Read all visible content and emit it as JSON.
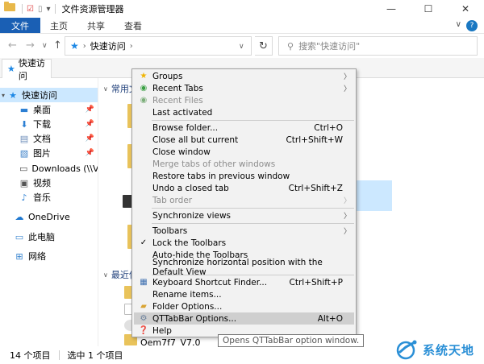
{
  "window": {
    "title": "文件资源管理器",
    "controls": {
      "minimize": "—",
      "maximize": "☐",
      "close": "✕"
    }
  },
  "ribbon": {
    "tabs": [
      "文件",
      "主页",
      "共享",
      "查看"
    ],
    "collapse": "∨",
    "help": "?"
  },
  "address": {
    "back": "←",
    "forward": "→",
    "recent": "∨",
    "up": "↑",
    "path": "快速访问",
    "chevron": "›",
    "dropdown": "∨",
    "refresh": "↻",
    "search_placeholder": "搜索\"快速访问\""
  },
  "qttab": {
    "tab_label": "快速访问"
  },
  "sidebar": {
    "items": [
      {
        "label": "快速访问",
        "icon": "star-icon",
        "pinned": false
      },
      {
        "label": "桌面",
        "icon": "desktop-icon",
        "pinned": true
      },
      {
        "label": "下载",
        "icon": "download-icon",
        "pinned": true
      },
      {
        "label": "文档",
        "icon": "document-icon",
        "pinned": true
      },
      {
        "label": "图片",
        "icon": "picture-icon",
        "pinned": true
      },
      {
        "label": "Downloads (\\\\VBo:",
        "icon": "network-drive-icon",
        "pinned": false
      },
      {
        "label": "视频",
        "icon": "video-icon",
        "pinned": false
      },
      {
        "label": "音乐",
        "icon": "music-icon",
        "pinned": false
      },
      {
        "label": "OneDrive",
        "icon": "cloud-icon",
        "pinned": false
      },
      {
        "label": "此电脑",
        "icon": "computer-icon",
        "pinned": false
      },
      {
        "label": "网络",
        "icon": "network-icon",
        "pinned": false
      }
    ]
  },
  "main": {
    "group_frequent": "常用文",
    "group_recent": "最近使",
    "recent_file": "Oem7f7_V7.0",
    "recent_file_suffix": "载"
  },
  "status": {
    "item_count": "14 个项目",
    "selected": "选中 1 个项目"
  },
  "context_menu": {
    "items": [
      {
        "label": "Groups",
        "shortcut": "",
        "submenu": true,
        "disabled": false,
        "icon": "star-icon"
      },
      {
        "label": "Recent Tabs",
        "shortcut": "",
        "submenu": true,
        "disabled": false,
        "icon": "recent-tabs-icon"
      },
      {
        "label": "Recent Files",
        "shortcut": "",
        "submenu": false,
        "disabled": true,
        "icon": "recent-files-icon"
      },
      {
        "label": "Last activated",
        "shortcut": "",
        "submenu": false,
        "disabled": false,
        "icon": ""
      },
      {
        "label": "Browse folder...",
        "shortcut": "Ctrl+O",
        "submenu": false,
        "disabled": false,
        "icon": ""
      },
      {
        "label": "Close all but current",
        "shortcut": "Ctrl+Shift+W",
        "submenu": false,
        "disabled": false,
        "icon": ""
      },
      {
        "label": "Close window",
        "shortcut": "",
        "submenu": false,
        "disabled": false,
        "icon": ""
      },
      {
        "label": "Merge tabs of other windows",
        "shortcut": "",
        "submenu": false,
        "disabled": true,
        "icon": ""
      },
      {
        "label": "Restore tabs in previous window",
        "shortcut": "",
        "submenu": false,
        "disabled": false,
        "icon": ""
      },
      {
        "label": "Undo a closed tab",
        "shortcut": "Ctrl+Shift+Z",
        "submenu": false,
        "disabled": false,
        "icon": ""
      },
      {
        "label": "Tab order",
        "shortcut": "",
        "submenu": true,
        "disabled": true,
        "icon": ""
      },
      {
        "label": "Synchronize views",
        "shortcut": "",
        "submenu": true,
        "disabled": false,
        "icon": ""
      },
      {
        "label": "Toolbars",
        "shortcut": "",
        "submenu": true,
        "disabled": false,
        "icon": ""
      },
      {
        "label": "Lock the Toolbars",
        "shortcut": "",
        "submenu": false,
        "disabled": false,
        "icon": "check-icon"
      },
      {
        "label": "Auto-hide the Toolbars",
        "shortcut": "",
        "submenu": false,
        "disabled": false,
        "icon": ""
      },
      {
        "label": "Synchronize horizontal position with the Default View",
        "shortcut": "",
        "submenu": false,
        "disabled": false,
        "icon": ""
      },
      {
        "label": "Keyboard Shortcut Finder...",
        "shortcut": "Ctrl+Shift+P",
        "submenu": false,
        "disabled": false,
        "icon": "keyboard-icon"
      },
      {
        "label": "Rename items...",
        "shortcut": "",
        "submenu": false,
        "disabled": false,
        "icon": ""
      },
      {
        "label": "Folder Options...",
        "shortcut": "",
        "submenu": false,
        "disabled": false,
        "icon": "folder-options-icon"
      },
      {
        "label": "QTTabBar Options...",
        "shortcut": "Alt+O",
        "submenu": false,
        "disabled": false,
        "icon": "gear-icon",
        "highlighted": true
      },
      {
        "label": "Help",
        "shortcut": "",
        "submenu": false,
        "disabled": false,
        "icon": "help-icon"
      }
    ]
  },
  "tooltip": "Opens QTTabBar option window.",
  "watermark": "系统天地",
  "colors": {
    "file_tab": "#1a5fb4",
    "selection": "#cce8ff",
    "accent": "#1e88e5"
  }
}
